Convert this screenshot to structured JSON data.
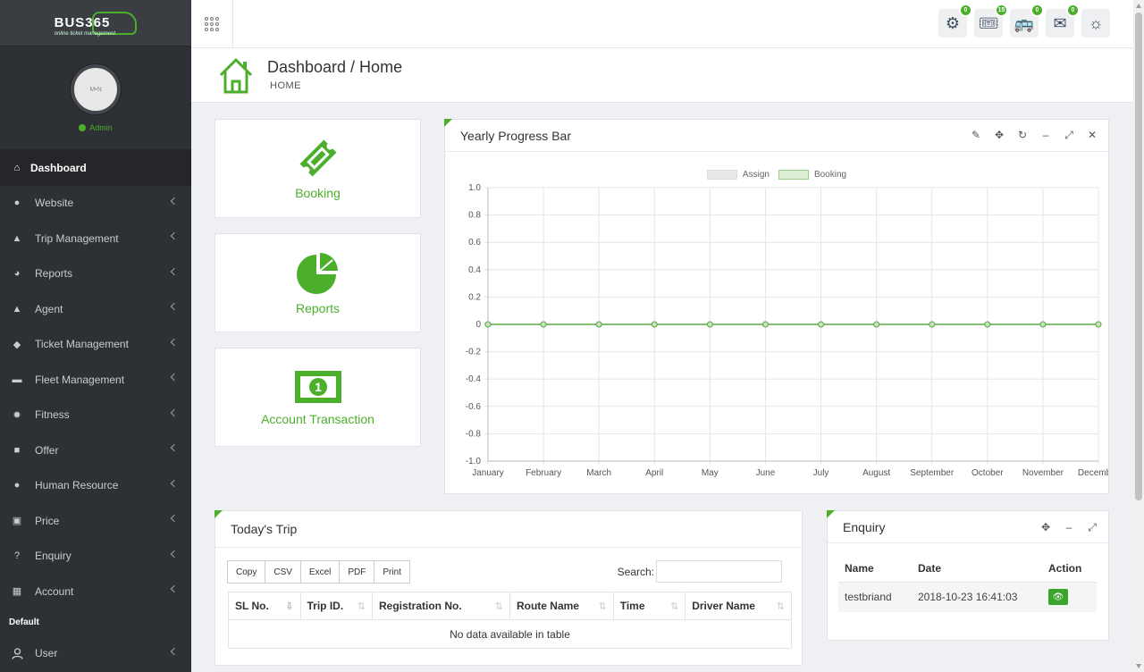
{
  "brand": {
    "name": "BUS365",
    "tagline": "online ticket management"
  },
  "profile": {
    "initials": "M•N",
    "role": "Admin"
  },
  "sidebar": {
    "items": [
      {
        "label": "Dashboard",
        "icon": "home-icon"
      },
      {
        "label": "Website",
        "icon": "globe-icon"
      },
      {
        "label": "Trip Management",
        "icon": "road-icon"
      },
      {
        "label": "Reports",
        "icon": "pie-icon"
      },
      {
        "label": "Agent",
        "icon": "user-icon"
      },
      {
        "label": "Ticket Management",
        "icon": "tag-icon"
      },
      {
        "label": "Fleet Management",
        "icon": "car-icon"
      },
      {
        "label": "Fitness",
        "icon": "gear-icon"
      },
      {
        "label": "Offer",
        "icon": "gift-icon"
      },
      {
        "label": "Human Resource",
        "icon": "users-icon"
      },
      {
        "label": "Price",
        "icon": "money-icon"
      },
      {
        "label": "Enquiry",
        "icon": "question-icon"
      },
      {
        "label": "Account",
        "icon": "calculator-icon"
      }
    ],
    "section": "Default",
    "user_item": {
      "label": "User",
      "icon": "user-outline-icon"
    }
  },
  "topbar": {
    "icons": [
      {
        "name": "settings-icon",
        "badge": "0"
      },
      {
        "name": "ticket-icon",
        "badge": "15"
      },
      {
        "name": "bus-icon",
        "badge": "0"
      },
      {
        "name": "mail-icon",
        "badge": "0"
      },
      {
        "name": "sun-icon",
        "badge": ""
      }
    ]
  },
  "header": {
    "title": "Dashboard / Home",
    "breadcrumb": "HOME"
  },
  "tiles": [
    {
      "label": "Booking",
      "icon": "ticket-icon"
    },
    {
      "label": "Reports",
      "icon": "pie-chart-icon"
    },
    {
      "label": "Account Transaction",
      "icon": "money-bill-icon"
    }
  ],
  "chart_panel": {
    "title": "Yearly Progress Bar"
  },
  "chart_data": {
    "type": "line",
    "title": "",
    "xlabel": "",
    "ylabel": "",
    "categories": [
      "January",
      "February",
      "March",
      "April",
      "May",
      "June",
      "July",
      "August",
      "September",
      "October",
      "November",
      "December"
    ],
    "ylim": [
      -1.0,
      1.0
    ],
    "yticks": [
      "1.0",
      "0.8",
      "0.6",
      "0.4",
      "0.2",
      "0",
      "-0.2",
      "-0.4",
      "-0.6",
      "-0.8",
      "-1.0"
    ],
    "series": [
      {
        "name": "Assign",
        "values": [
          0,
          0,
          0,
          0,
          0,
          0,
          0,
          0,
          0,
          0,
          0,
          0
        ],
        "color": "#cccccc"
      },
      {
        "name": "Booking",
        "values": [
          0,
          0,
          0,
          0,
          0,
          0,
          0,
          0,
          0,
          0,
          0,
          0
        ],
        "color": "#5aa84a"
      }
    ],
    "legend": "top-center",
    "grid": true
  },
  "trip_panel": {
    "title": "Today's Trip",
    "buttons": [
      "Copy",
      "CSV",
      "Excel",
      "PDF",
      "Print"
    ],
    "search_label": "Search:",
    "columns": [
      "SL No.",
      "Trip ID.",
      "Registration No.",
      "Route Name",
      "Time",
      "Driver Name"
    ],
    "empty_text": "No data available in table"
  },
  "enquiry_panel": {
    "title": "Enquiry",
    "columns": [
      "Name",
      "Date",
      "Action"
    ],
    "rows": [
      {
        "name": "testbriand",
        "date": "2018-10-23 16:41:03"
      }
    ]
  }
}
